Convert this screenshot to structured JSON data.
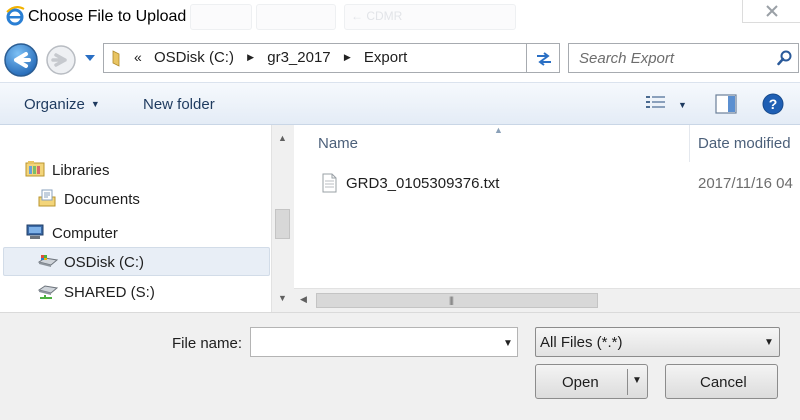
{
  "window": {
    "title": "Choose File to Upload",
    "background_tab_text": "← CDMR"
  },
  "navigation": {
    "back_icon": "back-arrow-icon",
    "forward_icon": "forward-arrow-icon",
    "address": {
      "overflow_marker": "«",
      "crumbs": [
        "OSDisk (C:)",
        "gr3_2017",
        "Export"
      ]
    },
    "search_placeholder": "Search Export"
  },
  "toolbar": {
    "organize_label": "Organize",
    "new_folder_label": "New folder"
  },
  "nav_pane": {
    "items": [
      {
        "label": "Libraries",
        "icon": "libraries-icon"
      },
      {
        "label": "Documents",
        "icon": "documents-icon"
      },
      {
        "label": "Computer",
        "icon": "computer-icon"
      },
      {
        "label": "OSDisk (C:)",
        "icon": "drive-icon",
        "selected": true
      },
      {
        "label": "SHARED (S:)",
        "icon": "network-drive-icon"
      }
    ]
  },
  "file_list": {
    "columns": [
      "Name",
      "Date modified"
    ],
    "rows": [
      {
        "name": "GRD3_0105309376.txt",
        "date": "2017/11/16 04",
        "icon": "text-file-icon"
      }
    ]
  },
  "footer": {
    "filename_label": "File name:",
    "filename_value": "",
    "filetype_value": "All Files (*.*)",
    "open_label": "Open",
    "cancel_label": "Cancel"
  },
  "colors": {
    "toolbar_text": "#1e3a5f",
    "header_text": "#4c607a",
    "accent_blue": "#2a6fc4"
  }
}
